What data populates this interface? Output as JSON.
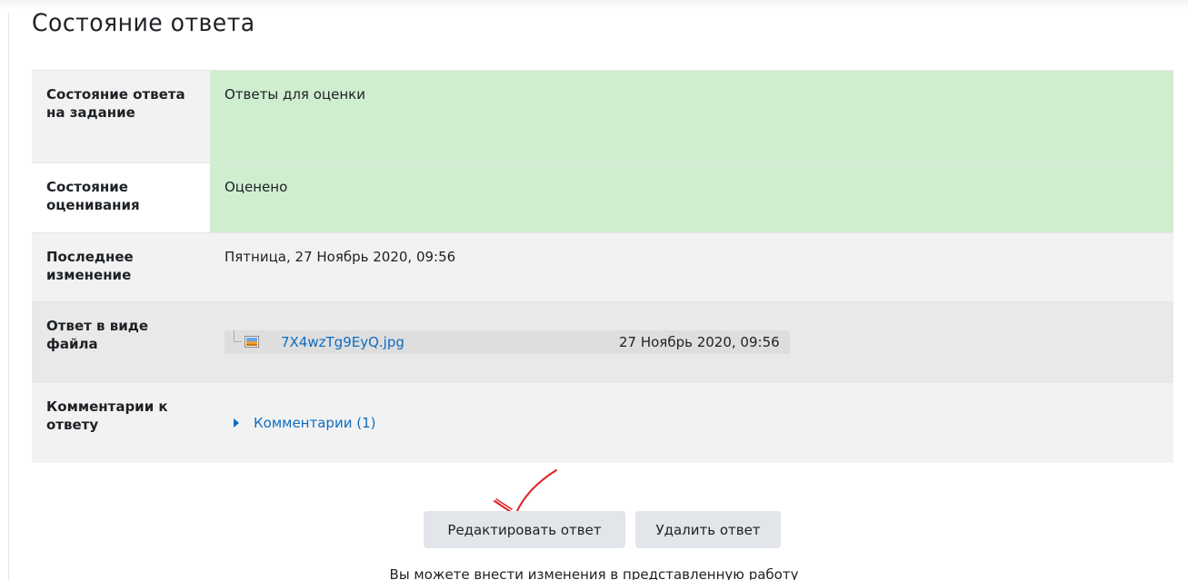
{
  "section_title": "Состояние ответа",
  "rows": {
    "submission_status": {
      "label": "Состояние ответа на задание",
      "value": "Ответы для оценки"
    },
    "grading_status": {
      "label": "Состояние оценивания",
      "value": "Оценено"
    },
    "last_modified": {
      "label": "Последнее изменение",
      "value": "Пятница, 27 Ноябрь 2020, 09:56"
    },
    "file_submission": {
      "label": "Ответ в виде файла",
      "file_name": "7X4wzTg9EyQ.jpg",
      "file_date": "27 Ноябрь 2020, 09:56",
      "file_icon": "image-file-icon"
    },
    "submission_comments": {
      "label": "Комментарии к ответу",
      "link": "Комментарии (1)",
      "icon": "triangle-right-icon"
    }
  },
  "buttons": {
    "edit": "Редактировать ответ",
    "delete": "Удалить ответ"
  },
  "hint": "Вы можете внести изменения в представленную работу",
  "colors": {
    "link": "#0f6cbf",
    "success_bg": "#cfeecf",
    "annotation_mark": "#e02020"
  }
}
